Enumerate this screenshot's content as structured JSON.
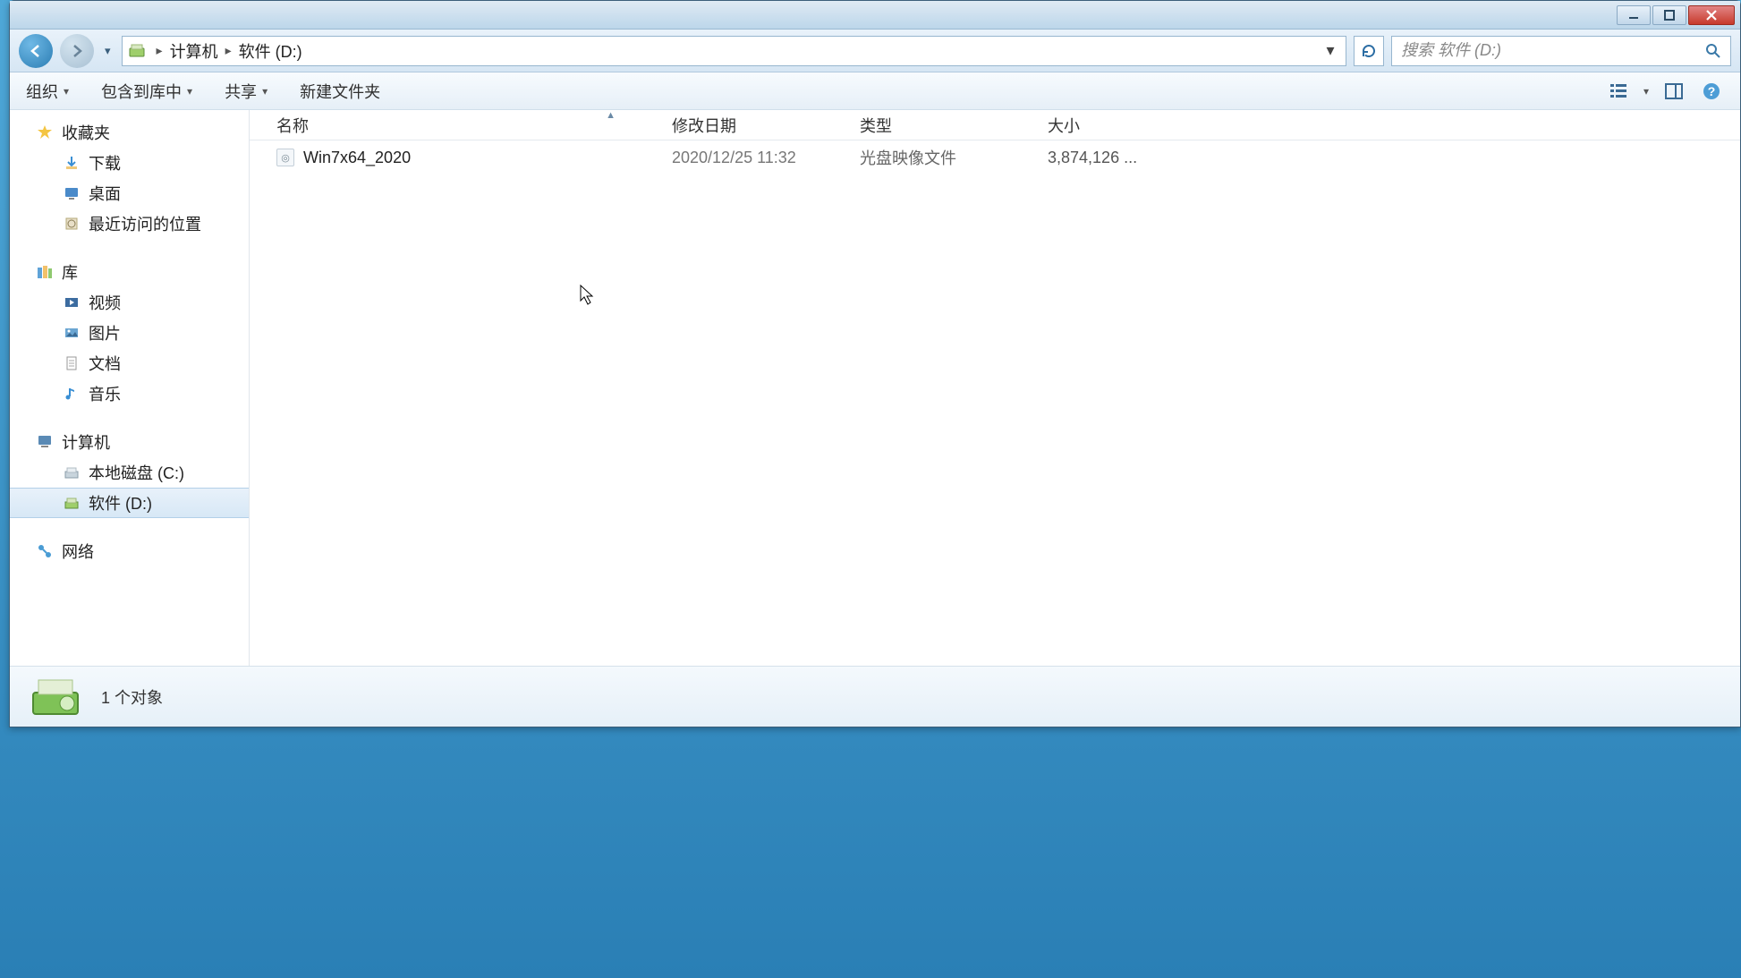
{
  "breadcrumb": {
    "computer": "计算机",
    "drive": "软件 (D:)"
  },
  "search": {
    "placeholder": "搜索 软件 (D:)"
  },
  "toolbar": {
    "organize": "组织",
    "include": "包含到库中",
    "share": "共享",
    "new_folder": "新建文件夹"
  },
  "sidebar": {
    "favorites": {
      "label": "收藏夹",
      "items": [
        "下载",
        "桌面",
        "最近访问的位置"
      ]
    },
    "libraries": {
      "label": "库",
      "items": [
        "视频",
        "图片",
        "文档",
        "音乐"
      ]
    },
    "computer": {
      "label": "计算机",
      "items": [
        "本地磁盘 (C:)",
        "软件 (D:)"
      ],
      "selected_index": 1
    },
    "network": {
      "label": "网络"
    }
  },
  "columns": {
    "name": "名称",
    "date": "修改日期",
    "type": "类型",
    "size": "大小"
  },
  "files": [
    {
      "name": "Win7x64_2020",
      "date": "2020/12/25 11:32",
      "type": "光盘映像文件",
      "size": "3,874,126 ..."
    }
  ],
  "status": "1 个对象"
}
